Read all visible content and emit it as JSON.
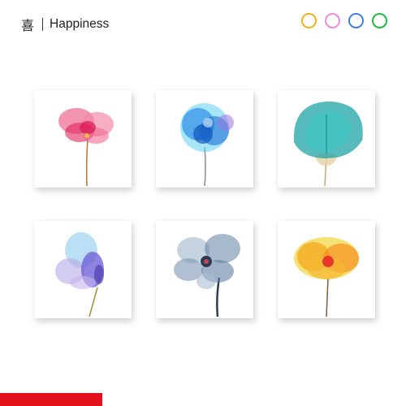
{
  "header": {
    "title_cn": "喜",
    "title_en": "Happiness"
  },
  "color_options": [
    {
      "name": "yellow",
      "color": "#f2b21c"
    },
    {
      "name": "pink",
      "color": "#ee8bd6"
    },
    {
      "name": "blue",
      "color": "#3e7fe8"
    },
    {
      "name": "green",
      "color": "#22b843"
    }
  ],
  "artworks": [
    {
      "name": "pink-watercolor-flower",
      "petal": "#ea3d6f",
      "accent": "#f48aa8",
      "stem": "#a67c3a",
      "icon": "flower-icon"
    },
    {
      "name": "blue-watercolor-flower",
      "petal": "#2f8fe6",
      "accent": "#5ed1f2",
      "stem": "#8c8c8c",
      "icon": "flower-icon"
    },
    {
      "name": "teal-watercolor-flower",
      "petal": "#1fa3a6",
      "accent": "#3cc8c4",
      "stem": "#c9a871",
      "icon": "flower-icon"
    },
    {
      "name": "purple-watercolor-flower",
      "petal": "#6b5ad6",
      "accent": "#8ecbf0",
      "stem": "#a88a3a",
      "icon": "flower-icon"
    },
    {
      "name": "slate-watercolor-flower",
      "petal": "#5f7fa3",
      "accent": "#9fb4c9",
      "stem": "#2e3f52",
      "icon": "flower-icon"
    },
    {
      "name": "orange-watercolor-flower",
      "petal": "#f5a418",
      "accent": "#f2d43a",
      "stem": "#7a5a3a",
      "icon": "flower-icon"
    }
  ],
  "accent_bar_color": "#e3111b"
}
